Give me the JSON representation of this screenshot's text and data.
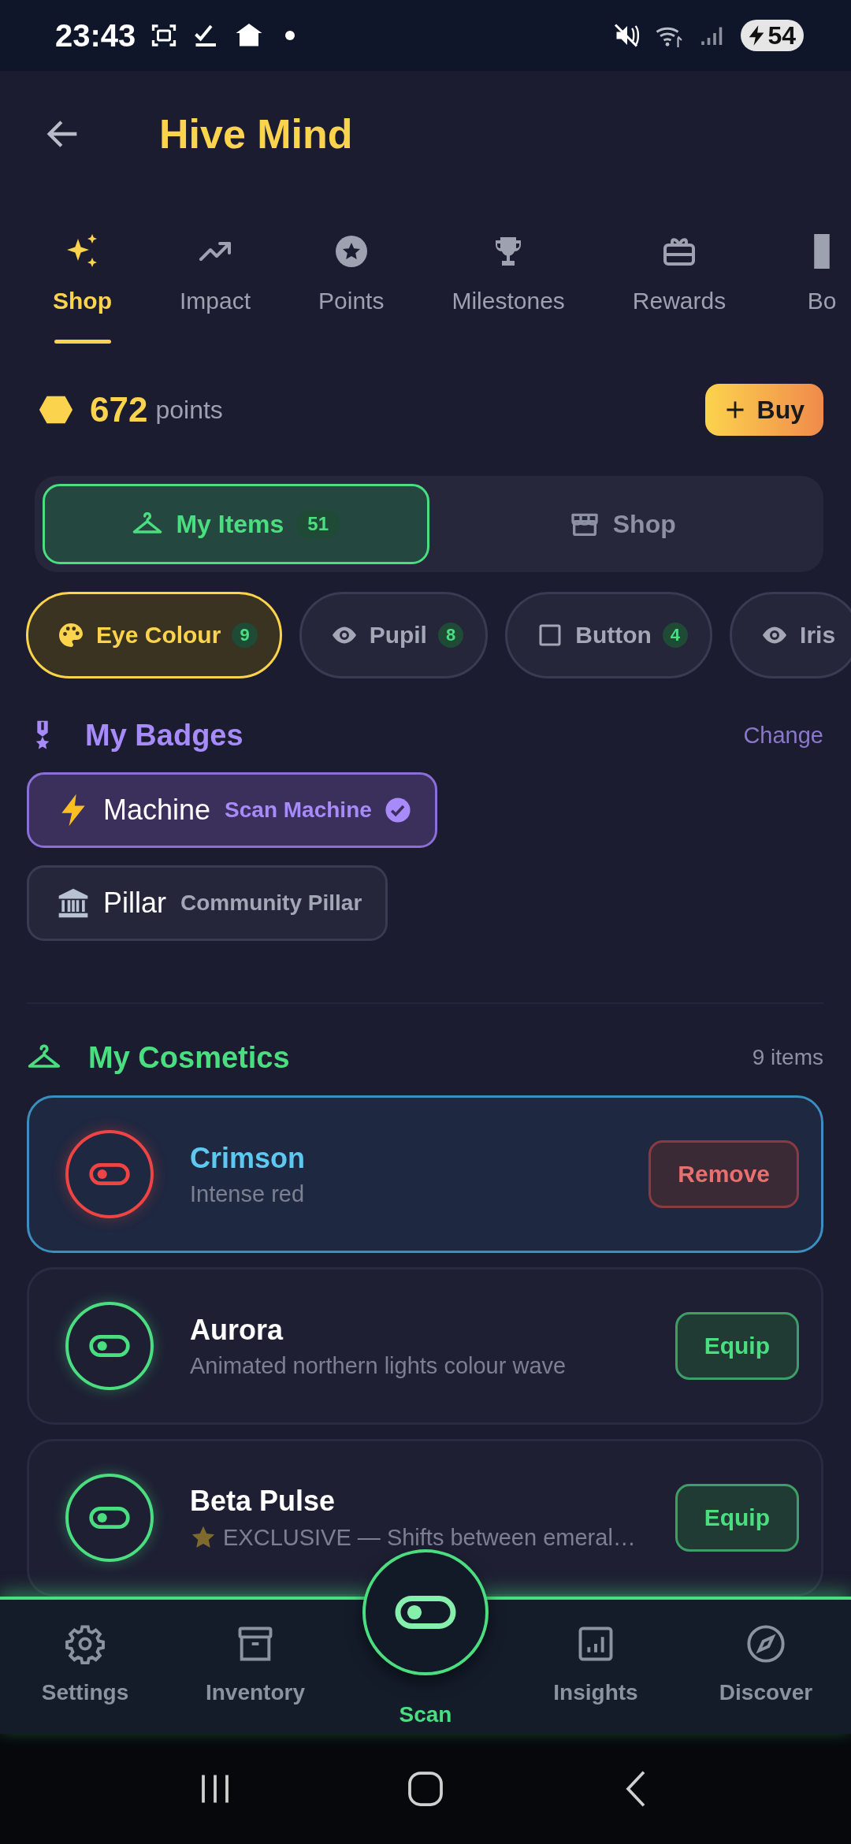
{
  "status_bar": {
    "time": "23:43",
    "battery": "54"
  },
  "header": {
    "title": "Hive Mind"
  },
  "tabs": [
    {
      "label": "Shop",
      "kind": "sparkles",
      "selected": true
    },
    {
      "label": "Impact",
      "kind": "trend",
      "selected": false
    },
    {
      "label": "Points",
      "kind": "star",
      "selected": false
    },
    {
      "label": "Milestones",
      "kind": "trophy",
      "selected": false
    },
    {
      "label": "Rewards",
      "kind": "gift",
      "selected": false
    },
    {
      "label": "Bo",
      "kind": "bar",
      "selected": false
    }
  ],
  "points": {
    "value": "672",
    "unit": "points"
  },
  "buy_button": {
    "label": "Buy"
  },
  "segments": [
    {
      "label": "My Items",
      "count": "51",
      "kind": "hanger",
      "selected": true
    },
    {
      "label": "Shop",
      "kind": "store",
      "selected": false
    }
  ],
  "filters": [
    {
      "label": "Eye Colour",
      "count": "9",
      "kind": "palette",
      "selected": true
    },
    {
      "label": "Pupil",
      "count": "8",
      "kind": "eye",
      "selected": false
    },
    {
      "label": "Button",
      "count": "4",
      "kind": "square",
      "selected": false
    },
    {
      "label": "Iris",
      "kind": "eye",
      "selected": false
    }
  ],
  "badges_section": {
    "title": "My Badges",
    "action": "Change"
  },
  "badges": [
    {
      "name": "Machine",
      "title": "Scan Machine",
      "kind": "bolt",
      "selected": true
    },
    {
      "name": "Pillar",
      "title": "Community Pillar",
      "kind": "temple",
      "selected": false
    }
  ],
  "cosmetics_section": {
    "title": "My Cosmetics",
    "count": "9 items"
  },
  "cosmetics": [
    {
      "name": "Crimson",
      "description": "Intense red",
      "color": "#ef4444",
      "equipped": true,
      "exclusive": false,
      "action": "Remove"
    },
    {
      "name": "Aurora",
      "description": "Animated northern lights colour wave",
      "color": "#4ade80",
      "equipped": false,
      "exclusive": false,
      "action": "Equip"
    },
    {
      "name": "Beta Pulse",
      "description": "EXCLUSIVE — Shifts between emeral…",
      "color": "#4ade80",
      "equipped": false,
      "exclusive": true,
      "action": "Equip"
    }
  ],
  "bottom_nav": [
    {
      "label": "Settings",
      "kind": "gear",
      "selected": false
    },
    {
      "label": "Inventory",
      "kind": "archive",
      "selected": false
    },
    {
      "label": "Scan",
      "kind": "scan",
      "selected": true
    },
    {
      "label": "Insights",
      "kind": "chart",
      "selected": false
    },
    {
      "label": "Discover",
      "kind": "compass",
      "selected": false
    }
  ]
}
